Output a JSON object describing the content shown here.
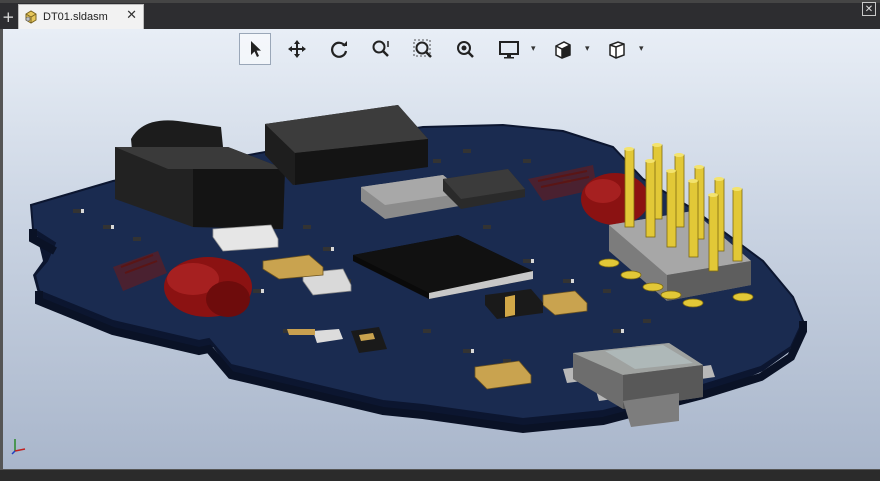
{
  "document_tab": {
    "title": "DT01.sldasm",
    "close_glyph": "✕",
    "icon": "assembly-icon"
  },
  "new_tab_glyph": "+",
  "window_close_glyph": "✕",
  "toolbar": {
    "tools": [
      {
        "name": "select-tool",
        "icon": "arrow-cursor-icon",
        "active": true
      },
      {
        "name": "pan-tool",
        "icon": "move-arrows-icon",
        "active": false
      },
      {
        "name": "rotate-tool",
        "icon": "rotate-icon",
        "active": false
      },
      {
        "name": "zoom-tool",
        "icon": "zoom-icon",
        "active": false
      },
      {
        "name": "zoom-area-tool",
        "icon": "zoom-area-icon",
        "active": false
      },
      {
        "name": "zoom-fit-tool",
        "icon": "zoom-fit-icon",
        "active": false
      },
      {
        "name": "display-style-tool",
        "icon": "monitor-icon",
        "active": false,
        "dropdown": true
      },
      {
        "name": "section-view-tool",
        "icon": "section-view-icon",
        "active": false,
        "dropdown": true
      },
      {
        "name": "view-orientation-tool",
        "icon": "cube-view-icon",
        "active": false,
        "dropdown": true
      }
    ],
    "dropdown_glyph": "▾"
  },
  "colors": {
    "pcb": "#18284a",
    "pcb_edge": "#0f1a33",
    "led": "#8a1010",
    "header_pins": "#e8d23a",
    "viewport_top": "#e8eef6",
    "viewport_bottom": "#a9b6cb"
  }
}
